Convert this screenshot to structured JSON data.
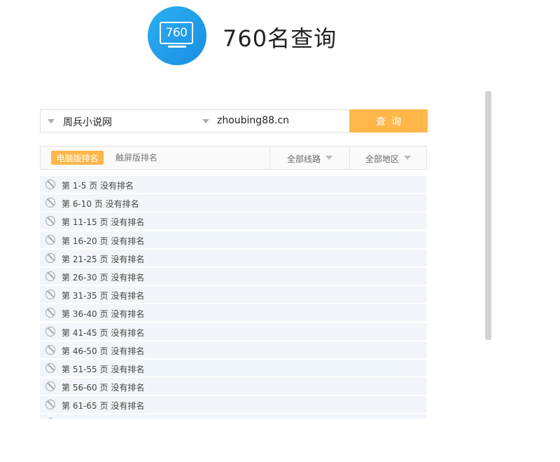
{
  "brand": {
    "logo_text": "760",
    "title": "760名查询"
  },
  "search": {
    "site_name": "周兵小说网",
    "domain": "zhoubing88.cn",
    "query_button": "查询"
  },
  "filters": {
    "tab_pc": "电脑版排名",
    "tab_touch": "触屏版排名",
    "route": "全部线路",
    "region": "全部地区"
  },
  "results": [
    "第 1-5 页 没有排名",
    "第 6-10 页 没有排名",
    "第 11-15 页 没有排名",
    "第 16-20 页 没有排名",
    "第 21-25 页 没有排名",
    "第 26-30 页 没有排名",
    "第 31-35 页 没有排名",
    "第 36-40 页 没有排名",
    "第 41-45 页 没有排名",
    "第 46-50 页 没有排名",
    "第 51-55 页 没有排名",
    "第 56-60 页 没有排名",
    "第 61-65 页 没有排名",
    ""
  ],
  "colors": {
    "accent": "#ffb74a",
    "logo": "#1a8de3",
    "row_bg": "#f2f6fa"
  },
  "icons": {
    "result_status": "no-entry-icon",
    "dropdown": "caret-down-icon",
    "logo": "monitor-icon"
  }
}
